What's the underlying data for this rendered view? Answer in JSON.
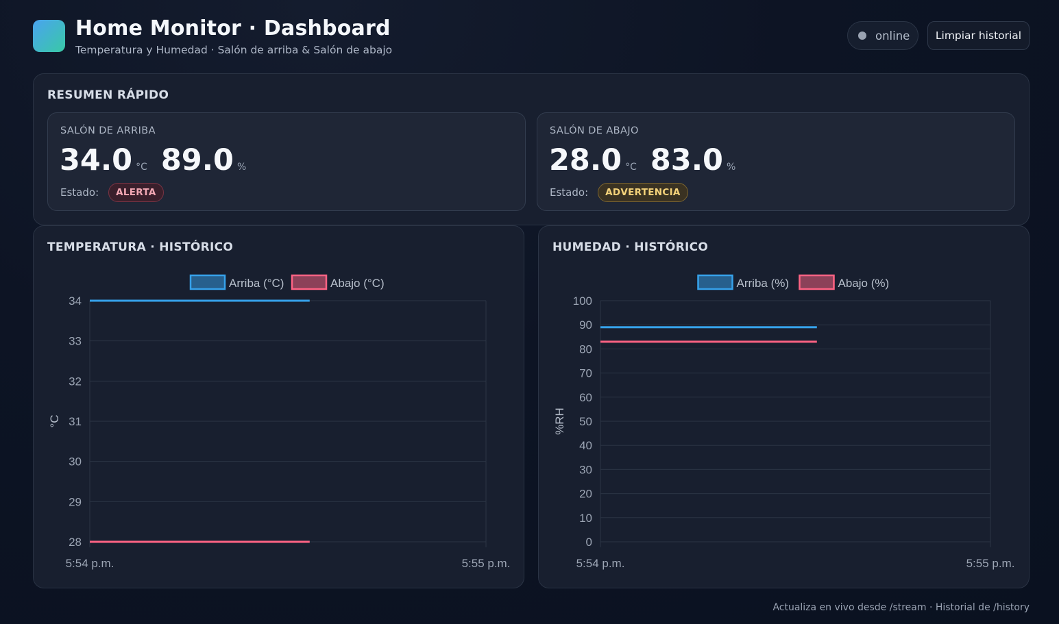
{
  "header": {
    "title": "Home Monitor · Dashboard",
    "subtitle": "Temperatura y Humedad · Salón de arriba & Salón de abajo",
    "status": "online",
    "clear_button": "Limpiar historial"
  },
  "summary": {
    "title": "RESUMEN RÁPIDO",
    "estado_label": "Estado:",
    "rooms": [
      {
        "name": "SALÓN DE ARRIBA",
        "temp": "34.0",
        "temp_unit": "°C",
        "hum": "89.0",
        "hum_unit": "%",
        "status": "ALERTA"
      },
      {
        "name": "SALÓN DE ABAJO",
        "temp": "28.0",
        "temp_unit": "°C",
        "hum": "83.0",
        "hum_unit": "%",
        "status": "ADVERTENCIA"
      }
    ]
  },
  "colors": {
    "arriba": "#36a2eb",
    "abajo": "#ff6384",
    "alert": "#f3a8b4",
    "warning": "#f4d27a"
  },
  "chart_data": [
    {
      "type": "line",
      "title": "TEMPERATURA · HISTÓRICO",
      "ylabel": "°C",
      "ylim": [
        28,
        34
      ],
      "yticks": [
        34,
        33,
        32,
        31,
        30,
        29,
        28
      ],
      "xticks": [
        "5:54 p.m.",
        "5:55 p.m."
      ],
      "grid": true,
      "legend": "top-center",
      "series": [
        {
          "name": "Arriba (°C)",
          "color": "#36a2eb",
          "x_fraction": [
            0,
            0.555
          ],
          "values": [
            34,
            34
          ]
        },
        {
          "name": "Abajo (°C)",
          "color": "#ff6384",
          "x_fraction": [
            0,
            0.555
          ],
          "values": [
            28,
            28
          ]
        }
      ]
    },
    {
      "type": "line",
      "title": "HUMEDAD · HISTÓRICO",
      "ylabel": "%RH",
      "ylim": [
        0,
        100
      ],
      "yticks": [
        100,
        90,
        80,
        70,
        60,
        50,
        40,
        30,
        20,
        10,
        0
      ],
      "xticks": [
        "5:54 p.m.",
        "5:55 p.m."
      ],
      "grid": true,
      "legend": "top-center",
      "series": [
        {
          "name": "Arriba (%)",
          "color": "#36a2eb",
          "x_fraction": [
            0,
            0.555
          ],
          "values": [
            89,
            89
          ]
        },
        {
          "name": "Abajo (%)",
          "color": "#ff6384",
          "x_fraction": [
            0,
            0.555
          ],
          "values": [
            83,
            83
          ]
        }
      ]
    }
  ],
  "footer": "Actualiza en vivo desde /stream · Historial de /history"
}
